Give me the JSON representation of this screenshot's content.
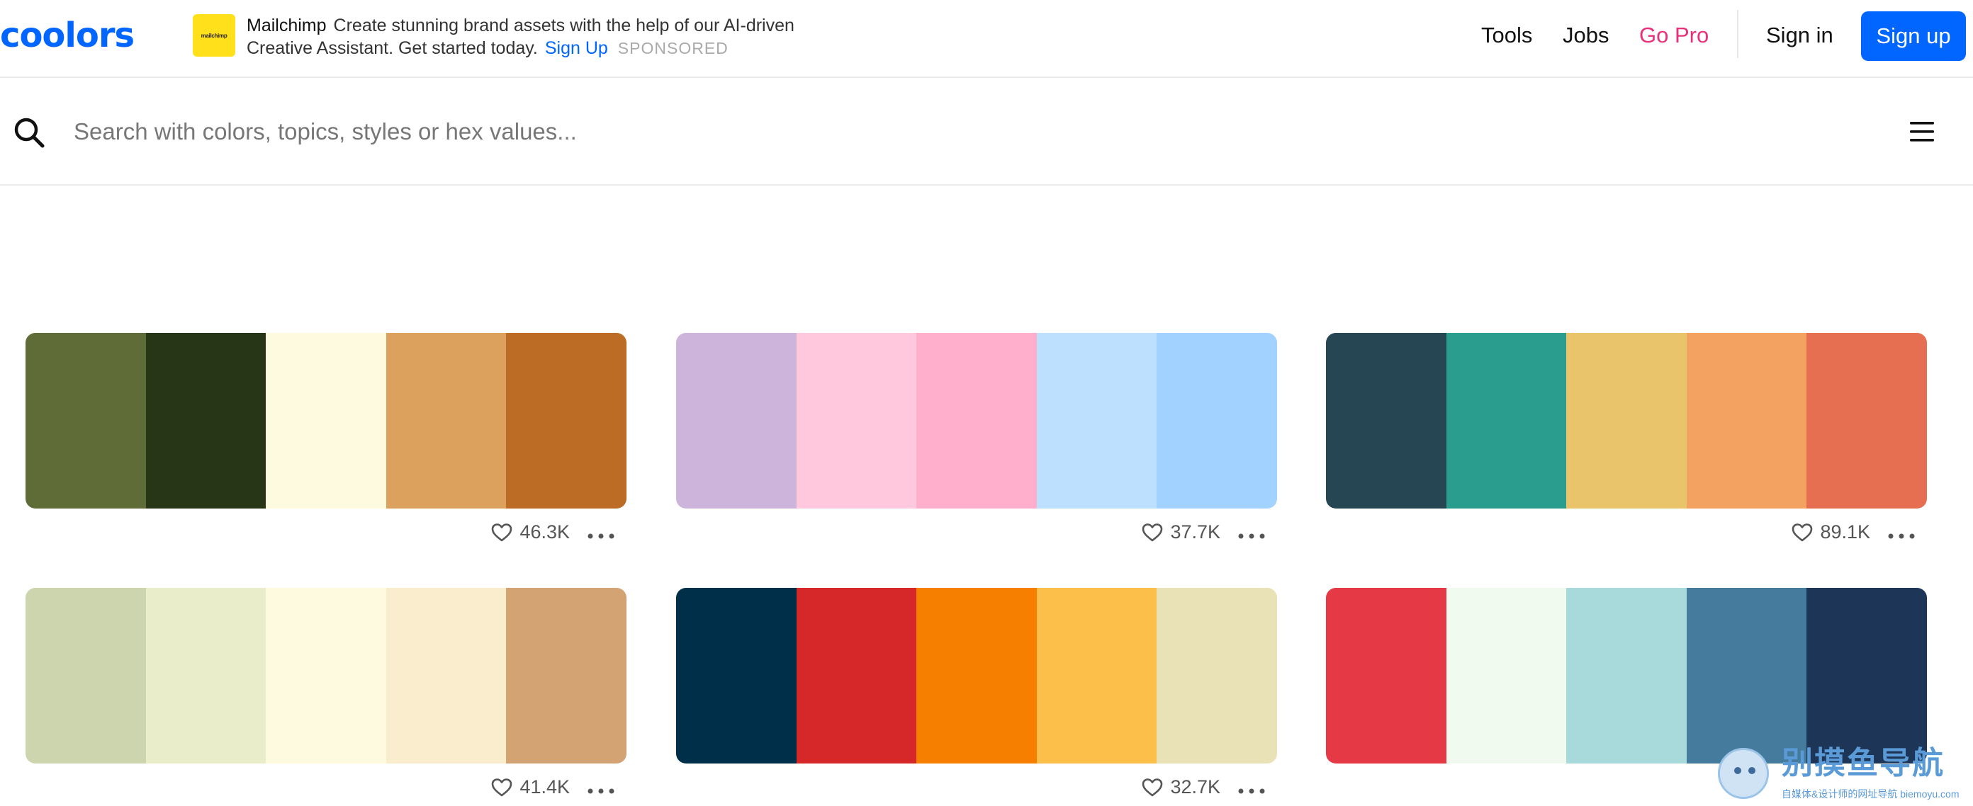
{
  "header": {
    "logo": "coolors",
    "nav": {
      "tools": "Tools",
      "jobs": "Jobs",
      "go_pro": "Go Pro",
      "sign_in": "Sign in",
      "sign_up": "Sign up"
    },
    "accent_color": "#0066ff",
    "go_pro_color": "#e8307b"
  },
  "ad": {
    "logo_text": "mailchimp",
    "brand": "Mailchimp",
    "text": "Create stunning brand assets with the help of our AI-driven Creative Assistant. Get started today.",
    "cta": "Sign Up",
    "sponsored": "SPONSORED"
  },
  "search": {
    "placeholder": "Search with colors, topics, styles or hex values...",
    "value": "",
    "icon": "search-icon",
    "menu_icon": "hamburger-menu-icon"
  },
  "palettes": [
    {
      "colors": [
        "#606c38",
        "#283618",
        "#fefae0",
        "#dda15e",
        "#bc6c25"
      ],
      "likes": "46.3K"
    },
    {
      "colors": [
        "#cdb4db",
        "#ffc8dd",
        "#ffafcc",
        "#bde0fe",
        "#a2d2ff"
      ],
      "likes": "37.7K"
    },
    {
      "colors": [
        "#264653",
        "#2a9d8f",
        "#e9c46a",
        "#f4a261",
        "#e76f51"
      ],
      "likes": "89.1K"
    },
    {
      "colors": [
        "#ccd5ae",
        "#e9edc9",
        "#fefae0",
        "#faedcd",
        "#d4a373"
      ],
      "likes": "41.4K"
    },
    {
      "colors": [
        "#003049",
        "#d62828",
        "#f77f00",
        "#fcbf49",
        "#eae2b7"
      ],
      "likes": "32.7K"
    },
    {
      "colors": [
        "#e63946",
        "#f1faee",
        "#a8dadc",
        "#457b9d",
        "#1d3557"
      ],
      "likes": ""
    }
  ],
  "watermark": {
    "title": "别摸鱼导航",
    "subtitle": "自媒体&设计师的网址导航 biemoyu.com"
  }
}
